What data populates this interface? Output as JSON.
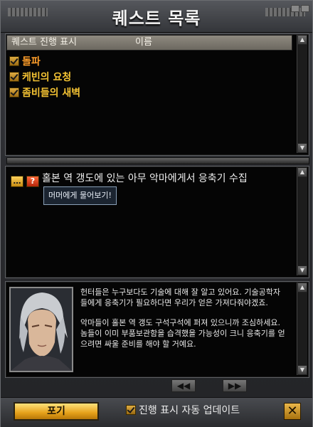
{
  "window": {
    "title": "퀘스트 목록"
  },
  "list": {
    "header_track": "퀘스트 진행 표시",
    "header_name": "이름",
    "quests": [
      {
        "label": "돌파",
        "checked": true
      },
      {
        "label": "케빈의 요청",
        "checked": true
      },
      {
        "label": "좀비들의 새벽",
        "checked": true
      }
    ]
  },
  "detail": {
    "objective": "홀본 역 갱도에 있는 아무 악마에게서 응축기 수집",
    "tooltip": "머머에게 물어보기!"
  },
  "dialogue": {
    "paragraph1": "헌터들은 누구보다도 기술에 대해 잘 알고 있어요. 기술공학자들에게 응축기가 필요하다면 우리가 얻은 가져다줘야겠죠.",
    "paragraph2": "악마들이 홀본 역 갱도 구석구석에 퍼져 있으니까 조심하세요. 놈들이 이미 부품보관함을 습격했을 가능성이 크니 응축기를 얻으려면 싸울 준비를 해야 할 거예요."
  },
  "nav": {
    "prev": "◀◀",
    "next": "▶▶"
  },
  "footer": {
    "giveup": "포기",
    "auto_update": "진행 표시 자동 업데이트",
    "auto_update_checked": true,
    "close": "✕"
  },
  "colors": {
    "accent": "#f3c233",
    "frame": "#2b2c30",
    "button": "#e6a11a"
  }
}
